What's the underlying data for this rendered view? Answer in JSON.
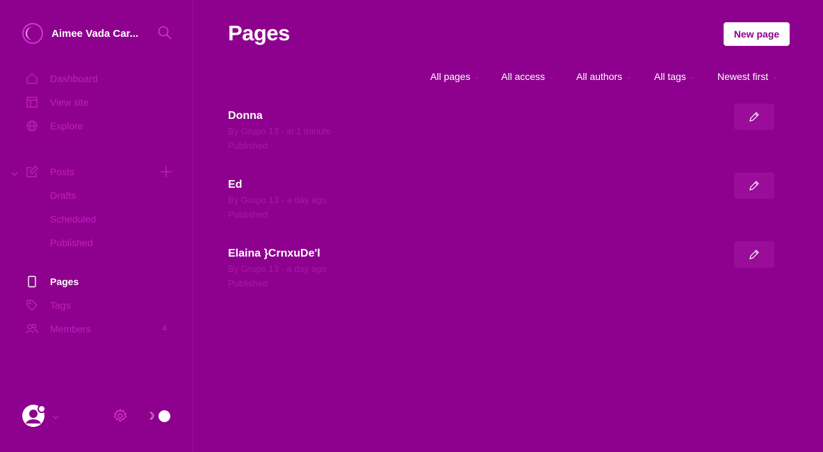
{
  "site": {
    "title": "Aimee Vada Car..."
  },
  "nav": {
    "dashboard": "Dashboard",
    "view_site": "View site",
    "explore": "Explore",
    "posts": "Posts",
    "drafts": "Drafts",
    "scheduled": "Scheduled",
    "published": "Published",
    "pages": "Pages",
    "tags": "Tags",
    "members": "Members",
    "members_count": "4"
  },
  "header": {
    "title": "Pages",
    "new_button": "New page"
  },
  "filters": {
    "type": "All pages",
    "access": "All access",
    "authors": "All authors",
    "tags": "All tags",
    "sort": "Newest first"
  },
  "pages": [
    {
      "title": "Donna",
      "meta": "By Grupo 13 - in 1 minute",
      "status": "Published"
    },
    {
      "title": "Ed",
      "meta": "By Grupo 13 - a day ago",
      "status": "Published"
    },
    {
      "title": "Elaina }CrnxuDe'l",
      "meta": "By Grupo 13 - a day ago",
      "status": "Published"
    }
  ],
  "icons": {
    "search": "search-icon",
    "dashboard": "home-icon",
    "view_site": "layout-icon",
    "explore": "globe-icon",
    "posts": "edit-icon",
    "pages": "page-icon",
    "tags": "tag-icon",
    "members": "members-icon",
    "settings": "gear-icon",
    "edit": "pencil-icon",
    "theme": "moon-icon"
  },
  "colors": {
    "background": "#8e018e",
    "accent": "#c21ec2",
    "text": "#ffffff"
  }
}
